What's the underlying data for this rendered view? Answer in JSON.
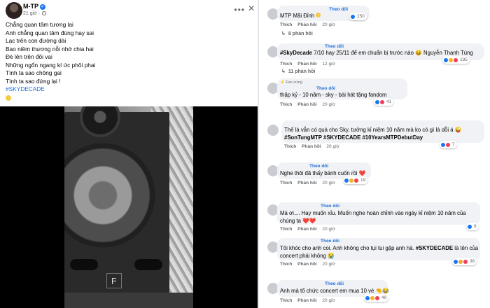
{
  "post": {
    "author": "M-TP",
    "time": "21 giờ",
    "caption_lines": [
      "Chẳng quan tâm tương lai",
      "Anh chẳng quan tâm đúng hay sai",
      "Lạc trên con đường dài",
      "Bao niềm thương nỗi nhớ chia hai",
      "Đè lên trên đôi vai",
      "Những ngổn ngang kí ức phôi phai",
      "Tình ta sao chông gai",
      "Tình ta sao đứng lại !"
    ],
    "hashtag": "#SKYDECADE"
  },
  "labels": {
    "follow": "Theo dõi",
    "like": "Thích",
    "reply": "Phản hồi",
    "fan_badge": "Fan cứng"
  },
  "comments": [
    {
      "text": "MTP Mãi Đỉnh ",
      "time": "20 giờ",
      "reactions": "250",
      "replies": "8 phản hồi"
    },
    {
      "text_bold": "#SkyDecade",
      "text": " 7/10 hay 25/11 để em chuẩn bị trước nào 😆 Nguyễn Thanh Tùng",
      "time": "12 giờ",
      "reactions": "185",
      "replies": "11 phản hồi"
    },
    {
      "text": "thập kỷ - 10 năm - sky - bài hát tặng fandom",
      "time": "20 giờ",
      "reactions": "41"
    },
    {
      "text": "Thế là vẫn có quà cho Sky, tưởng kỉ niệm 10 năm mà ko có gì là dỗi á 😜",
      "text_bold": "#SonTungMTP #SKYDECADE #10YearsMTPDebutDay",
      "time": "20 giờ",
      "reactions": "7"
    },
    {
      "text": "Nghe thôi đã thấy bánh cuốn rồi ❤️",
      "time": "20 giờ",
      "reactions": "19"
    },
    {
      "text": "Má ơi.... Hay muốn xỉu. Muốn nghe hoàn chỉnh vào ngày kỉ niệm 10 năm của chúng ta ❤️❤️",
      "time": "20 giờ",
      "reactions": "6"
    },
    {
      "text": "Tôi khóc cho anh coi. Anh không cho tụi tui gặp anh hả. ",
      "text_bold": "#SKYDECADE",
      "text_tail": " là tên của concert phải không 😭",
      "time": "20 giờ",
      "reactions": "36"
    },
    {
      "text": "Anh mà tổ chức concert em mua 10 vé 🤏😂",
      "time": "20 giờ",
      "reactions": "49"
    }
  ]
}
